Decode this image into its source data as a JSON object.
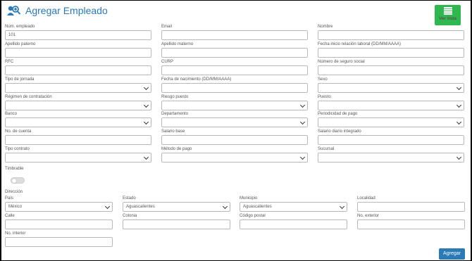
{
  "header": {
    "title": "Agregar Empleado",
    "icon": "add-user-icon"
  },
  "list_button": {
    "label": "Ver lista",
    "icon": "list-icon"
  },
  "fields": [
    {
      "id": "num-empleado",
      "label": "Núm. empleado",
      "value": "101",
      "type": "text"
    },
    {
      "id": "email",
      "label": "Email",
      "value": "",
      "type": "text"
    },
    {
      "id": "nombre",
      "label": "Nombre",
      "value": "",
      "type": "text"
    },
    {
      "id": "apellido-paterno",
      "label": "Apellido paterno",
      "value": "",
      "type": "text"
    },
    {
      "id": "apellido-materno",
      "label": "Apellido materno",
      "value": "",
      "type": "text"
    },
    {
      "id": "fecha-inicio",
      "label": "Fecha inicio relación laboral (DD/MM/AAAA)",
      "value": "",
      "type": "text"
    },
    {
      "id": "rfc",
      "label": "RFC",
      "value": "",
      "type": "text"
    },
    {
      "id": "curp",
      "label": "CURP",
      "value": "",
      "type": "text"
    },
    {
      "id": "nss",
      "label": "Número de seguro social",
      "value": "",
      "type": "text"
    },
    {
      "id": "tipo-jornada",
      "label": "Tipo de jornada",
      "value": "",
      "type": "select"
    },
    {
      "id": "fecha-nacimiento",
      "label": "Fecha de nacimiento (DD/MM/AAAA)",
      "value": "",
      "type": "text"
    },
    {
      "id": "sexo",
      "label": "Sexo",
      "value": "",
      "type": "select"
    },
    {
      "id": "regimen",
      "label": "Régimen de contratación",
      "value": "",
      "type": "select"
    },
    {
      "id": "riesgo-puesto",
      "label": "Riesgo puesto",
      "value": "",
      "type": "select"
    },
    {
      "id": "puesto",
      "label": "Puesto",
      "value": "",
      "type": "select"
    },
    {
      "id": "banco",
      "label": "Banco",
      "value": "",
      "type": "select"
    },
    {
      "id": "departamento",
      "label": "Departamento",
      "value": "",
      "type": "select"
    },
    {
      "id": "periodicidad",
      "label": "Periodicidad de pago",
      "value": "",
      "type": "select"
    },
    {
      "id": "cuenta",
      "label": "No. de cuenta",
      "value": "",
      "type": "text"
    },
    {
      "id": "salario-base",
      "label": "Salario base",
      "value": "",
      "type": "text"
    },
    {
      "id": "salario-diario",
      "label": "Salario diario integrado",
      "value": "",
      "type": "text"
    },
    {
      "id": "tipo-contrato",
      "label": "Tipo contrato",
      "value": "",
      "type": "select"
    },
    {
      "id": "metodo-pago",
      "label": "Método de pago",
      "value": "",
      "type": "select"
    },
    {
      "id": "sucursal",
      "label": "Sucursal",
      "value": "",
      "type": "select"
    }
  ],
  "timbrable": {
    "label": "Timbrable",
    "on": false
  },
  "address": {
    "title": "Dirección",
    "fields": [
      {
        "id": "pais",
        "label": "País",
        "value": "México",
        "type": "select"
      },
      {
        "id": "estado",
        "label": "Estado",
        "value": "Aguascalientes",
        "type": "select"
      },
      {
        "id": "municipio",
        "label": "Municipio",
        "value": "Aguascalientes",
        "type": "select"
      },
      {
        "id": "localidad",
        "label": "Localidad",
        "value": "",
        "type": "text"
      },
      {
        "id": "calle",
        "label": "Calle",
        "value": "",
        "type": "text"
      },
      {
        "id": "colonia",
        "label": "Colonia",
        "value": "",
        "type": "text"
      },
      {
        "id": "codigo-postal",
        "label": "Código postal",
        "value": "",
        "type": "text"
      },
      {
        "id": "no-exterior",
        "label": "No. exterior",
        "value": "",
        "type": "text"
      },
      {
        "id": "no-interior",
        "label": "No. interior",
        "value": "",
        "type": "text"
      }
    ]
  },
  "submit": {
    "label": "Agregar"
  },
  "colors": {
    "accent": "#2a7ab8",
    "list_button": "#2eb84f"
  }
}
